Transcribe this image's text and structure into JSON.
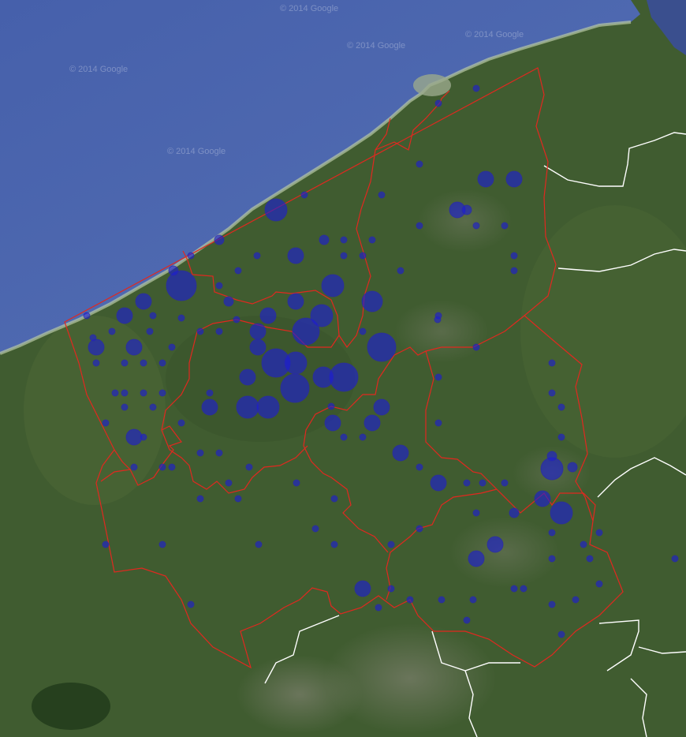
{
  "map": {
    "watermark": "© 2014 Google",
    "colors": {
      "sea": "#4a62ad",
      "land": "#3f5a2e",
      "district_border": "#e1281f",
      "country_border": "#ffffff",
      "marker_fill": "#1a1ad8"
    }
  },
  "markers": [
    {
      "id": "m1",
      "size": "large"
    },
    {
      "id": "m2",
      "size": "large"
    },
    {
      "id": "m3",
      "size": "large"
    },
    {
      "id": "m4",
      "size": "large"
    },
    {
      "id": "m5",
      "size": "large"
    },
    {
      "id": "m6",
      "size": "large"
    },
    {
      "id": "m7",
      "size": "large"
    },
    {
      "id": "m8",
      "size": "large"
    },
    {
      "id": "m9",
      "size": "large"
    },
    {
      "id": "m10",
      "size": "large"
    },
    {
      "id": "m11",
      "size": "medium"
    },
    {
      "id": "m12",
      "size": "medium"
    },
    {
      "id": "m13",
      "size": "medium"
    },
    {
      "id": "m14",
      "size": "medium"
    },
    {
      "id": "m15",
      "size": "medium"
    },
    {
      "id": "m16",
      "size": "medium"
    },
    {
      "id": "m17",
      "size": "medium"
    },
    {
      "id": "m18",
      "size": "medium"
    },
    {
      "id": "m19",
      "size": "medium"
    },
    {
      "id": "m20",
      "size": "medium"
    },
    {
      "id": "m21",
      "size": "medium"
    },
    {
      "id": "m22",
      "size": "medium"
    },
    {
      "id": "m23",
      "size": "medium"
    },
    {
      "id": "m24",
      "size": "medium"
    },
    {
      "id": "m25",
      "size": "medium"
    },
    {
      "id": "m26",
      "size": "medium"
    },
    {
      "id": "m27",
      "size": "medium"
    },
    {
      "id": "m28",
      "size": "medium"
    },
    {
      "id": "m29",
      "size": "medium"
    },
    {
      "id": "m30",
      "size": "medium"
    },
    {
      "id": "m31",
      "size": "medium"
    },
    {
      "id": "m32",
      "size": "medium"
    },
    {
      "id": "m33",
      "size": "medium"
    },
    {
      "id": "m34",
      "size": "medium"
    },
    {
      "id": "m35",
      "size": "medium"
    },
    {
      "id": "m36",
      "size": "medium"
    },
    {
      "id": "m37",
      "size": "medium"
    },
    {
      "id": "m38",
      "size": "medium"
    },
    {
      "id": "m39",
      "size": "medium"
    },
    {
      "id": "m40",
      "size": "medium"
    },
    {
      "id": "m41",
      "size": "medium"
    },
    {
      "id": "m42",
      "size": "medium"
    },
    {
      "id": "m43",
      "size": "medium"
    },
    {
      "id": "m44",
      "size": "medium"
    },
    {
      "id": "m45",
      "size": "medium"
    },
    {
      "id": "m46",
      "size": "medium"
    },
    {
      "id": "m47",
      "size": "medium"
    },
    {
      "id": "m48",
      "size": "medium"
    },
    {
      "id": "m49",
      "size": "small"
    },
    {
      "id": "m50",
      "size": "small"
    },
    {
      "id": "m51",
      "size": "small"
    },
    {
      "id": "m52",
      "size": "small"
    },
    {
      "id": "m53",
      "size": "small"
    },
    {
      "id": "m54",
      "size": "small"
    },
    {
      "id": "m55",
      "size": "small"
    },
    {
      "id": "m56",
      "size": "small"
    },
    {
      "id": "m57",
      "size": "small"
    },
    {
      "id": "m58",
      "size": "small"
    },
    {
      "id": "m59",
      "size": "small"
    },
    {
      "id": "m60",
      "size": "small"
    },
    {
      "id": "m61",
      "size": "small"
    },
    {
      "id": "m62",
      "size": "small"
    },
    {
      "id": "m63",
      "size": "small"
    },
    {
      "id": "m64",
      "size": "small"
    },
    {
      "id": "m65",
      "size": "small"
    },
    {
      "id": "m66",
      "size": "small"
    },
    {
      "id": "m67",
      "size": "small"
    },
    {
      "id": "m68",
      "size": "small"
    },
    {
      "id": "m69",
      "size": "small"
    },
    {
      "id": "m70",
      "size": "small"
    },
    {
      "id": "m71",
      "size": "small"
    },
    {
      "id": "m72",
      "size": "small"
    },
    {
      "id": "m73",
      "size": "small"
    },
    {
      "id": "m74",
      "size": "small"
    },
    {
      "id": "m75",
      "size": "small"
    },
    {
      "id": "m76",
      "size": "small"
    },
    {
      "id": "m77",
      "size": "small"
    },
    {
      "id": "m78",
      "size": "small"
    },
    {
      "id": "m79",
      "size": "small"
    },
    {
      "id": "m80",
      "size": "small"
    },
    {
      "id": "m81",
      "size": "small"
    },
    {
      "id": "m82",
      "size": "small"
    },
    {
      "id": "m83",
      "size": "small"
    },
    {
      "id": "m84",
      "size": "small"
    },
    {
      "id": "m85",
      "size": "small"
    },
    {
      "id": "m86",
      "size": "small"
    },
    {
      "id": "m87",
      "size": "small"
    },
    {
      "id": "m88",
      "size": "small"
    },
    {
      "id": "m89",
      "size": "small"
    },
    {
      "id": "m90",
      "size": "small"
    },
    {
      "id": "m91",
      "size": "small"
    },
    {
      "id": "m92",
      "size": "small"
    },
    {
      "id": "m93",
      "size": "small"
    },
    {
      "id": "m94",
      "size": "small"
    },
    {
      "id": "m95",
      "size": "small"
    },
    {
      "id": "m96",
      "size": "small"
    },
    {
      "id": "m97",
      "size": "small"
    },
    {
      "id": "m98",
      "size": "small"
    },
    {
      "id": "m99",
      "size": "small"
    },
    {
      "id": "m100",
      "size": "small"
    },
    {
      "id": "m101",
      "size": "small"
    },
    {
      "id": "m102",
      "size": "small"
    },
    {
      "id": "m103",
      "size": "small"
    },
    {
      "id": "m104",
      "size": "small"
    },
    {
      "id": "m105",
      "size": "small"
    },
    {
      "id": "m106",
      "size": "small"
    },
    {
      "id": "m107",
      "size": "small"
    },
    {
      "id": "m108",
      "size": "small"
    },
    {
      "id": "m109",
      "size": "small"
    },
    {
      "id": "m110",
      "size": "small"
    },
    {
      "id": "m111",
      "size": "small"
    },
    {
      "id": "m112",
      "size": "small"
    },
    {
      "id": "m113",
      "size": "small"
    },
    {
      "id": "m114",
      "size": "small"
    },
    {
      "id": "m115",
      "size": "small"
    },
    {
      "id": "m116",
      "size": "small"
    },
    {
      "id": "m117",
      "size": "small"
    },
    {
      "id": "m118",
      "size": "small"
    },
    {
      "id": "m119",
      "size": "small"
    },
    {
      "id": "m120",
      "size": "small"
    },
    {
      "id": "m121",
      "size": "small"
    },
    {
      "id": "m122",
      "size": "small"
    },
    {
      "id": "m123",
      "size": "small"
    },
    {
      "id": "m124",
      "size": "small"
    },
    {
      "id": "m125",
      "size": "small"
    },
    {
      "id": "m126",
      "size": "small"
    },
    {
      "id": "m127",
      "size": "small"
    },
    {
      "id": "m128",
      "size": "small"
    },
    {
      "id": "m129",
      "size": "small"
    },
    {
      "id": "m130",
      "size": "small"
    },
    {
      "id": "m131",
      "size": "small"
    },
    {
      "id": "m132",
      "size": "small"
    },
    {
      "id": "m133",
      "size": "small"
    },
    {
      "id": "m134",
      "size": "small"
    },
    {
      "id": "m135",
      "size": "small"
    },
    {
      "id": "m136",
      "size": "small"
    },
    {
      "id": "m137",
      "size": "small"
    },
    {
      "id": "m138",
      "size": "small"
    },
    {
      "id": "m139",
      "size": "small"
    },
    {
      "id": "m140",
      "size": "small"
    },
    {
      "id": "m141",
      "size": "small"
    },
    {
      "id": "m142",
      "size": "small"
    },
    {
      "id": "m143",
      "size": "small"
    },
    {
      "id": "m144",
      "size": "small"
    },
    {
      "id": "m145",
      "size": "small"
    },
    {
      "id": "m146",
      "size": "small"
    }
  ]
}
